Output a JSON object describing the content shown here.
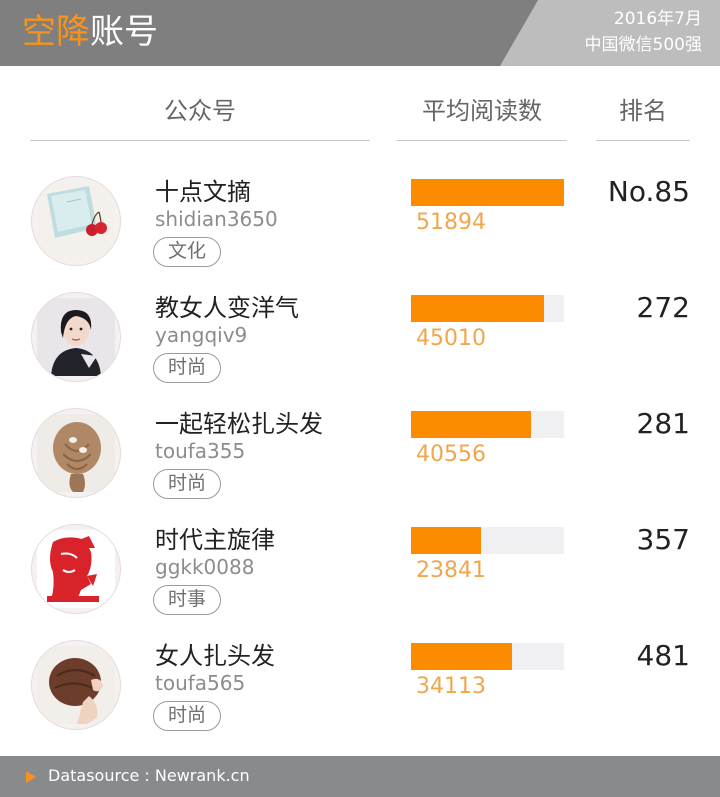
{
  "header": {
    "title_accent": "空降",
    "title_rest": "账号",
    "date": "2016年7月",
    "list_name": "中国微信500强"
  },
  "columns": {
    "account": "公众号",
    "avg_reads": "平均阅读数",
    "rank": "排名"
  },
  "chart_data": {
    "type": "bar",
    "orientation": "horizontal",
    "categories": [
      "十点文摘",
      "教女人变洋气",
      "一起轻松扎头发",
      "时代主旋律",
      "女人扎头发"
    ],
    "values": [
      51894,
      45010,
      40556,
      23841,
      34113
    ],
    "xlim": [
      0,
      51894
    ],
    "ylabel": "平均阅读数",
    "bar_color": "#fd8b00",
    "track_color": "#f0eff1"
  },
  "rows": [
    {
      "name": "十点文摘",
      "id": "shidian3650",
      "tag": "文化",
      "value_label": "51894",
      "rank": "No.85",
      "icon": "notebook-cherry-avatar"
    },
    {
      "name": "教女人变洋气",
      "id": "yangqiv9",
      "tag": "时尚",
      "value_label": "45010",
      "rank": "272",
      "icon": "woman-portrait-avatar"
    },
    {
      "name": "一起轻松扎头发",
      "id": "toufa355",
      "tag": "时尚",
      "value_label": "40556",
      "rank": "281",
      "icon": "braided-hair-avatar"
    },
    {
      "name": "时代主旋律",
      "id": "ggkk0088",
      "tag": "时事",
      "value_label": "23841",
      "rank": "357",
      "icon": "red-portrait-avatar"
    },
    {
      "name": "女人扎头发",
      "id": "toufa565",
      "tag": "时尚",
      "value_label": "34113",
      "rank": "481",
      "icon": "hair-bun-avatar"
    }
  ],
  "footer": {
    "source": "Datasource : Newrank.cn"
  },
  "colors": {
    "accent": "#f7931d",
    "header_bg": "#7f7f80",
    "header_right_bg": "#bdbdbe",
    "value_text": "#f0a64b",
    "footer_bg": "#898a8c"
  }
}
